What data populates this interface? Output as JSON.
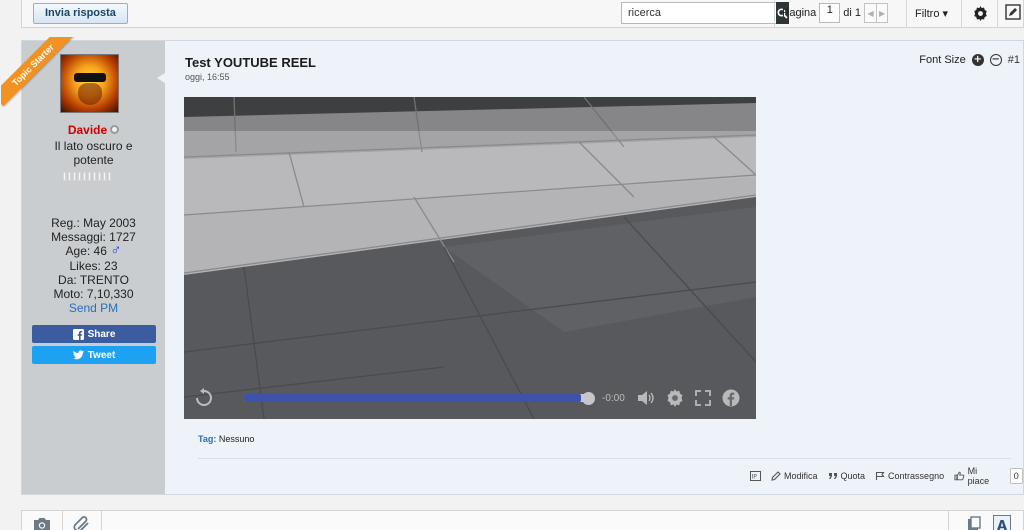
{
  "toolbar": {
    "reply_label": "Invia risposta",
    "search_placeholder": "ricerca",
    "page_label": "Pagina",
    "page_current": "1",
    "page_of": "di 1",
    "filter_label": "Filtro ▾"
  },
  "post": {
    "title": "Test YOUTUBE REEL",
    "date": "oggi, 16:55",
    "font_size_label": "Font Size",
    "post_number": "#1",
    "tags_label": "Tag:",
    "tags_value": "Nessuno"
  },
  "user": {
    "badge": "Topic Starter",
    "name": "Davide",
    "title": "Il lato oscuro e potente",
    "reputation_pips": 10,
    "reg": "Reg.: May 2003",
    "posts": "Messaggi: 1727",
    "age": "Age: 46",
    "gender_symbol": "♂",
    "likes": "Likes: 23",
    "from": "Da: TRENTO",
    "moto": "Moto: 7,10,330",
    "send_pm": "Send PM",
    "share_label": "Share",
    "tweet_label": "Tweet"
  },
  "video": {
    "time": "-0:00",
    "progress": 0.98
  },
  "actions": {
    "edit": "Modifica",
    "quote": "Quota",
    "flag": "Contrassegno",
    "like": "Mi piace",
    "like_count": "0"
  },
  "colors": {
    "accent": "#2a6ebc",
    "username": "#d40000",
    "badge": "#f29223",
    "facebook": "#3b5c9e",
    "twitter": "#1da1f2"
  }
}
